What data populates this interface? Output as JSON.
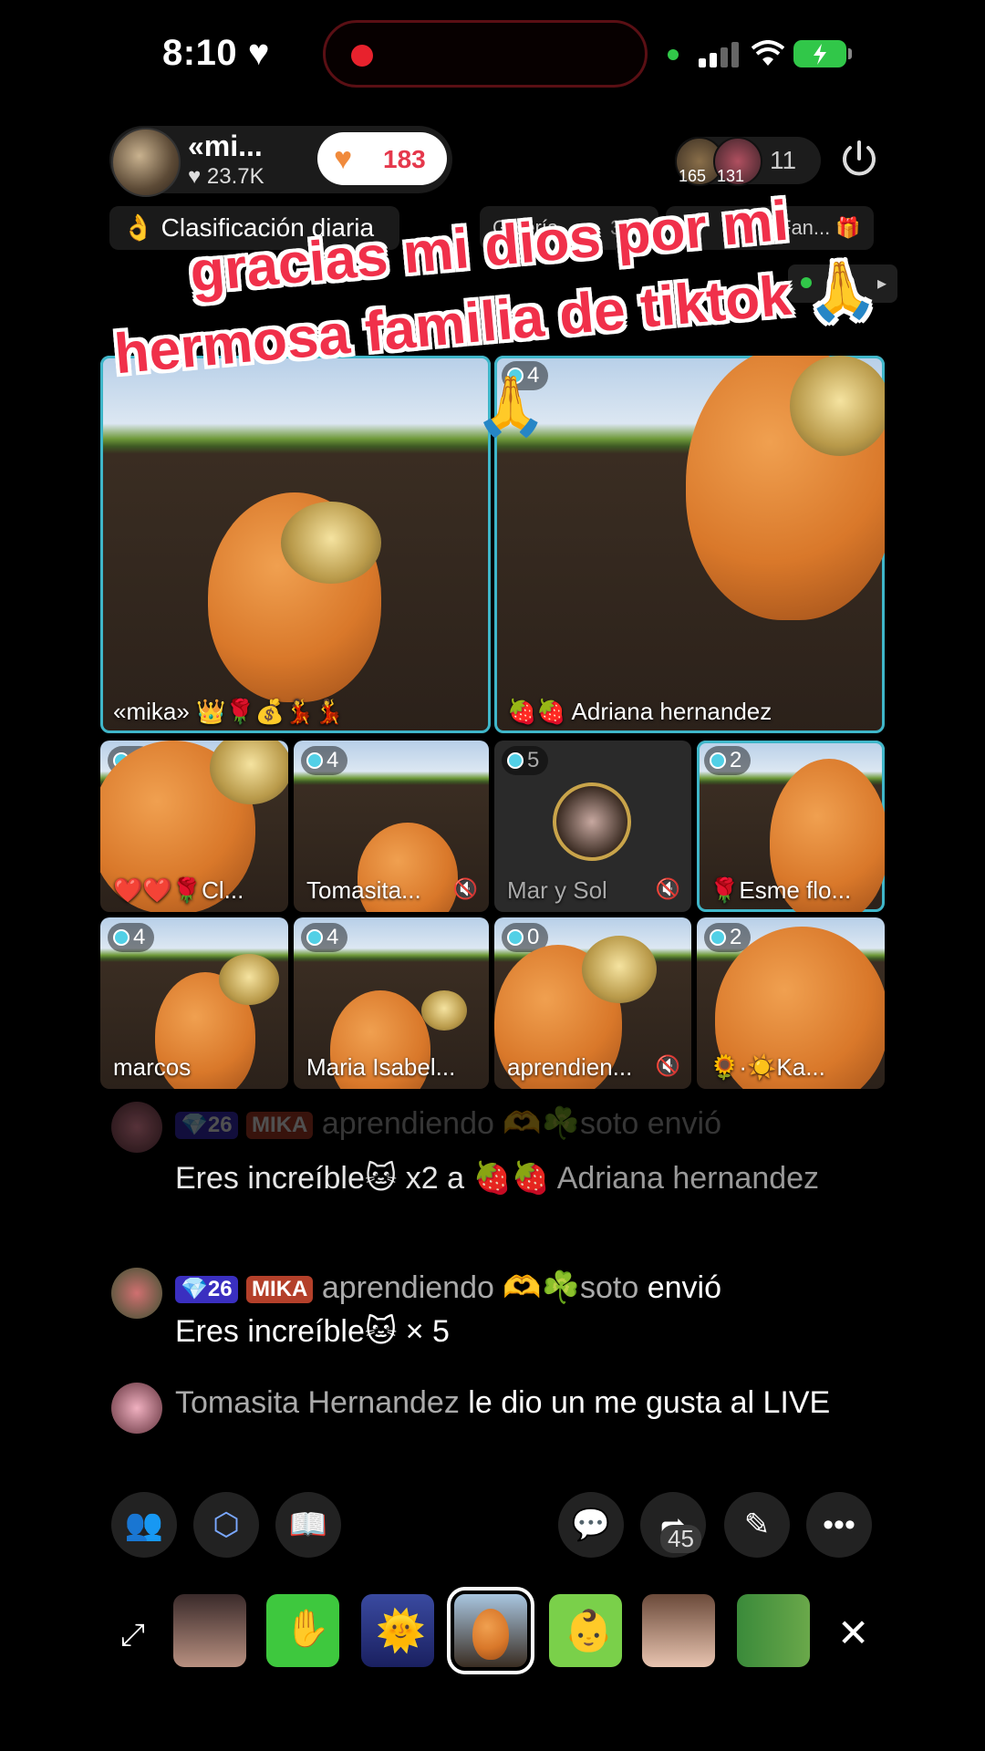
{
  "status_bar": {
    "time": "8:10",
    "time_icon": "heart-icon"
  },
  "host": {
    "name": "«mi...",
    "likes": "♥ 23.7K",
    "heart_count": "183"
  },
  "viewers": {
    "avatar1_count": "165",
    "avatar2_count": "131",
    "count": "11"
  },
  "chips": {
    "ranking": "👌 Clasificación diaria",
    "gallery": "Galería",
    "gallery_count": "3/13",
    "fan": "Fan..."
  },
  "caption": {
    "line1": "gracias mi dios por mi",
    "line2": "hermosa familia de tiktok 🙏",
    "emoji2": "🙏"
  },
  "tiles": [
    {
      "badge": "",
      "name": "«mika» 👑🌹💰💃💃"
    },
    {
      "badge": "4",
      "name": "🍓🍓 Adriana hernandez"
    },
    {
      "badge": "4",
      "name": "❤️❤️🌹Cl..."
    },
    {
      "badge": "4",
      "name": "Tomasita..."
    },
    {
      "badge": "5",
      "name": "Mar y Sol"
    },
    {
      "badge": "2",
      "name": "🌹Esme flo..."
    },
    {
      "badge": "4",
      "name": "marcos"
    },
    {
      "badge": "4",
      "name": "Maria Isabel..."
    },
    {
      "badge": "0",
      "name": "aprendien..."
    },
    {
      "badge": "2",
      "name": "🌻·☀️Ka..."
    }
  ],
  "chat": [
    {
      "level": "26",
      "tag": "MIKA",
      "user": "aprendiendo 🫶☘️soto envió",
      "text": "Eres increíble🐱 x2 a 🍓🍓",
      "target": "Adriana hernandez"
    },
    {
      "level": "26",
      "tag": "MIKA",
      "user": "aprendiendo 🫶☘️soto",
      "action": "envió",
      "text": "Eres increíble🐱 × 5"
    },
    {
      "user": "Tomasita Hernandez",
      "text": "le dio un me gusta al LIVE"
    }
  ],
  "toolbar": {
    "share_count": "45"
  },
  "colors": {
    "accent": "#f0304a",
    "tile_highlight": "#3fb6c9",
    "heart": "#e5384c"
  }
}
